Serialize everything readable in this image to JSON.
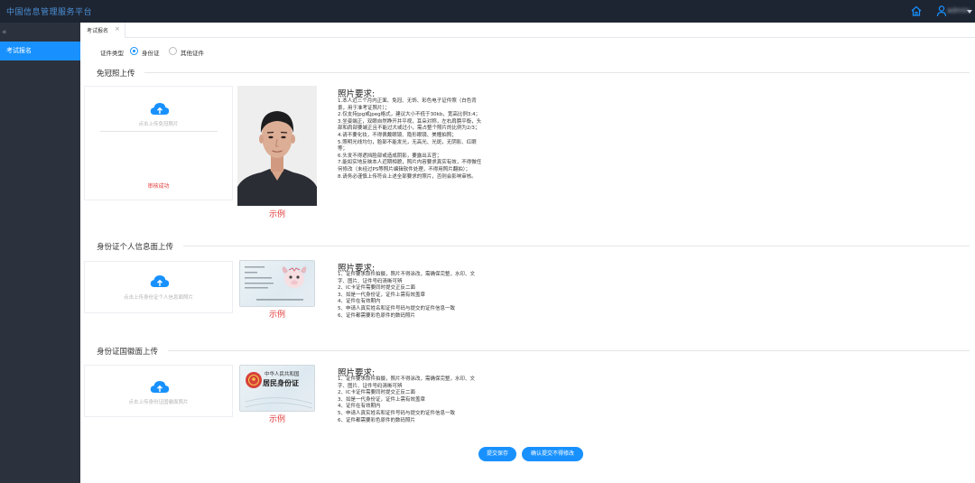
{
  "app": {
    "title": "中国信息管理服务平台",
    "user_name": "admin"
  },
  "icons": {
    "home": "home-icon",
    "user": "user-icon",
    "caret": "caret-down-icon",
    "collapse": "collapse-icon",
    "upload": "cloud-upload-icon",
    "close": "close-icon"
  },
  "colors": {
    "primary": "#1891ff",
    "sidebar": "#2b313d",
    "topbar": "#1e2532",
    "error": "#e23a3a"
  },
  "sidebar": {
    "collapse_glyph": "«",
    "items": [
      {
        "label": "考试报名",
        "active": true
      }
    ]
  },
  "tabs": [
    {
      "label": "考试报名",
      "close": "×"
    }
  ],
  "cert_type": {
    "label": "证件类型",
    "options": [
      {
        "label": "身份证",
        "selected": true
      },
      {
        "label": "其他证件",
        "selected": false
      }
    ]
  },
  "sections": {
    "photo": {
      "title": "免冠照上传",
      "upload_text": "点击上传免冠照片",
      "status": "审核成功",
      "sample_label": "示例",
      "req_title": "照片要求:",
      "requirements": [
        "1.本人近三个月内正面、免冠、无饰、彩色电子证件照（白色背景，用于准考证照片）；",
        "2.仅支持jpg或jpeg格式，建议大小不低于30kb，宽高比例3:4；",
        "3.坐姿端正，双眼自然睁开并平视，耳朵对称，左右肩膀平衡，头部和肩部要端正且不能过大或过小，需占整个照片的比例为2/3；",
        "4.请不要化妆，不得佩戴眼镜、隐形眼镜、美瞳拍照；",
        "5.照明光线均匀，脸部不能发光，无高光、光斑，无阴影、红眼等；",
        "6.头发不得遮挡脸部或造成阴影，要露出五官；",
        "7.能如实地反映本人近期相貌，照片内容要求真实有效，不得做任何修改（未经过PS等照片编辑软件处理，不得用照片翻拍）；",
        "8.请务必谨慎上传符合上述全部要求的照片，否则会影响审核。"
      ]
    },
    "id_front": {
      "title": "身份证个人信息面上传",
      "upload_text": "点击上传身份证个人信息面照片",
      "sample_label": "示例",
      "req_title": "照片要求:",
      "requirements": [
        "1、证件要求原件拍摄，照片不得涂改，需确保完整，水印、文字、图片、证件号码清晰可辨",
        "2、IC卡证件需要同时提交正反二面",
        "3、如是一代身份证，证件上需有效盖章",
        "4、证件在有效期内",
        "5、申请人真实姓名和证件号码与提交的证件信息一致",
        "6、证件都需要彩色原件的数码照片"
      ]
    },
    "id_back": {
      "title": "身份证国徽面上传",
      "upload_text": "点击上传身份证国徽面照片",
      "sample_label": "示例",
      "card_line1": "中华人民共和国",
      "card_line2": "居民身份证",
      "req_title": "照片要求:",
      "requirements": [
        "1、证件要求原件拍摄，照片不得涂改，需确保完整，水印、文字、图片、证件号码清晰可辨",
        "2、IC卡证件需要同时提交正反二面",
        "3、如是一代身份证，证件上需有效盖章",
        "4、证件在有效期内",
        "5、申请人真实姓名和证件号码与提交的证件信息一致",
        "6、证件都需要彩色原件的数码照片"
      ]
    }
  },
  "buttons": {
    "save": "提交保存",
    "confirm": "确认提交不得修改"
  }
}
